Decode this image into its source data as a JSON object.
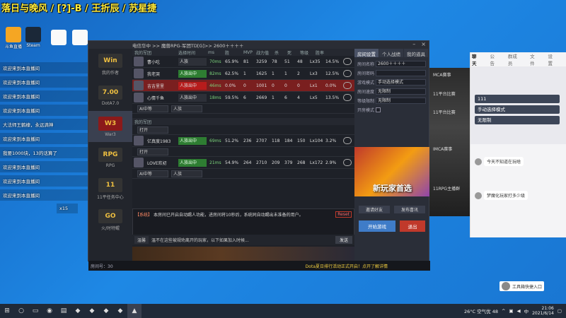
{
  "stream_title": "落日与晚风 / [?]-B / 王折辰 / 苏星捷",
  "desktop_icons": [
    {
      "label": "斗鱼直播",
      "color": "#f5a623"
    },
    {
      "label": "Steam",
      "color": "#1b2838"
    },
    {
      "label": "",
      "color": "#cccccc"
    },
    {
      "label": "",
      "color": "#e0e0e0"
    },
    {
      "label": "",
      "color": "#e0e0e0"
    }
  ],
  "chat_overlay": [
    "欢迎来到本直播间",
    "欢迎来到本直播间",
    "欢迎来到本直播间",
    "欢迎来到本直播间",
    "大法师王鹤棣，永远滴神",
    "欢迎来到本直播间",
    "我要1000块，13的话算了",
    "欢迎来到本直播间",
    "欢迎来到本直播间",
    "欢迎来到本直播间"
  ],
  "chat_overlay_count": "x15",
  "game_window": {
    "title": "电信华中 >> 魔兽RPG-军团TD[G]>> 2600＋＋＋＋",
    "left_items": [
      {
        "name": "我的作者",
        "logo": "Win",
        "active": false
      },
      {
        "name": "DotA7.0",
        "logo": "7.00",
        "active": false
      },
      {
        "name": "War3",
        "logo": "W3",
        "active": true
      },
      {
        "name": "RPG",
        "logo": "RPG",
        "active": false
      },
      {
        "name": "11平任务中心",
        "logo": "11",
        "active": false
      },
      {
        "name": "火/时特鲲",
        "logo": "GO",
        "active": false
      }
    ],
    "team1_label": "我的军团",
    "team2_label": "我的军团",
    "columns": [
      "选择时间",
      "ms",
      "胜",
      "MVP",
      "战力值",
      "杀",
      "死",
      "等级",
      "胜率"
    ],
    "team1": [
      {
        "name": "曹小吃",
        "status": "人族",
        "status_style": "",
        "ms": "70ms",
        "wr": "65.9%",
        "mvp": "81",
        "pts": "3259",
        "k": "78",
        "d": "51",
        "a": "48",
        "lv": "Lx35",
        "pct": "14.5%",
        "row_style": ""
      },
      {
        "name": "我老哭",
        "status": "人族出中",
        "status_style": "green",
        "ms": "82ms",
        "wr": "62.5%",
        "mvp": "1",
        "pts": "1625",
        "k": "1",
        "d": "1",
        "a": "2",
        "lv": "Lx3",
        "pct": "12.5%",
        "row_style": ""
      },
      {
        "name": "吉吉里里",
        "status": "人族出中",
        "status_style": "red",
        "ms": "46ms",
        "wr": "0.0%",
        "mvp": "0",
        "pts": "1001",
        "k": "0",
        "d": "0",
        "a": "0",
        "lv": "Lx1",
        "pct": "0.0%",
        "row_style": "red"
      },
      {
        "name": "心情千鱼",
        "status": "人族出中",
        "status_style": "",
        "ms": "18ms",
        "wr": "59.5%",
        "mvp": "6",
        "pts": "2669",
        "k": "1",
        "d": "6",
        "a": "4",
        "lv": "Lx5",
        "pct": "13.5%",
        "row_style": ""
      }
    ],
    "team1_slot": {
      "sel": "AI中等",
      "race": "人族"
    },
    "team2_open": "打开",
    "team2": [
      {
        "name": "亿真度1983",
        "status": "人族出中",
        "status_style": "green",
        "ms": "69ms",
        "wr": "51.2%",
        "mvp": "236",
        "pts": "2707",
        "k": "118",
        "d": "184",
        "a": "150",
        "lv": "Lx104",
        "pct": "3.2%",
        "row_style": ""
      },
      {
        "name": "LOVE欢初",
        "status": "人族出中",
        "status_style": "green",
        "ms": "21ms",
        "wr": "54.9%",
        "mvp": "264",
        "pts": "2710",
        "k": "209",
        "d": "379",
        "a": "268",
        "lv": "Lx172",
        "pct": "2.9%",
        "row_style": ""
      }
    ],
    "team2_open2": "打开",
    "team2_slot": {
      "sel": "AI中等",
      "race": "人族"
    },
    "system_msg_tag": "【系统】",
    "system_msg": "本房间已开启自动踢人功能，进房间将10秒后，系统同自动踢出未准备的用户。",
    "report_label": "Reset",
    "tip_text": "温馨",
    "input_hint": "温不在这些被规劝离开的玩家，以下如果加入时候...",
    "send_label": "发送",
    "right_tabs": [
      "房间设置",
      "个人战绩",
      "我的道具"
    ],
    "form": [
      {
        "label": "房间名称",
        "value": "2600＋＋＋＋"
      },
      {
        "label": "房间密码",
        "value": ""
      },
      {
        "label": "游戏模式",
        "value": "手动选择模式"
      },
      {
        "label": "房间速度",
        "value": "无限制"
      },
      {
        "label": "等级限制",
        "value": "无限制"
      },
      {
        "label": "开房模式",
        "value": ""
      }
    ],
    "ad_text": "新玩家首选",
    "btn_invite": "邀请好友",
    "btn_share": "发布喜讯",
    "btn_start": "开始游戏",
    "btn_exit": "退出",
    "status_bar": "房间号：30",
    "notice": "Dota夏日排行活动正式开启！点开了解详情"
  },
  "chat_window": {
    "bg_labels": [
      "MCA赛事",
      "11平台比赛",
      "11平台比赛",
      "IMCA赛事",
      "11RPG主播群"
    ],
    "tabs": [
      "聊天",
      "公告",
      "群成员",
      "文件",
      "设置"
    ],
    "room_field": "111",
    "mode_field": "手动选择模式",
    "limit_field": "无限制",
    "messages": [
      {
        "text": "今天不知道在玩啥"
      },
      {
        "text": "梦魔化玩家打多少级"
      }
    ]
  },
  "helper_label": "工具箱快捷入口",
  "taskbar": {
    "weather": "26°C 空气优 48",
    "lang": "中",
    "time": "21:06",
    "date": "2021/6/14"
  }
}
